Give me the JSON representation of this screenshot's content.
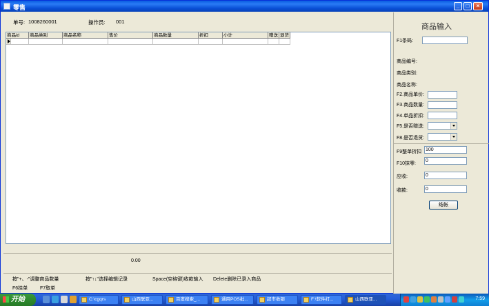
{
  "window": {
    "title": "零售"
  },
  "header": {
    "order_label": "单号:",
    "order_value": "1008260001",
    "operator_label": "操作员:",
    "operator_value": "001"
  },
  "grid": {
    "columns": [
      "商品id",
      "商品类别",
      "商品名称",
      "售价",
      "商品数量",
      "折扣",
      "小计",
      "赠送",
      "退货"
    ]
  },
  "totals": {
    "amount": "0.00"
  },
  "hints": {
    "adjust_qty": "按\"+、-\"调整商品数量",
    "select_record": "按\"↑↓\"选择编辑记录",
    "space_payment": "Space(空格键)收款输入",
    "delete_item": "Delete删除已录入商品",
    "hold_order": "F6挂单",
    "retrieve_order": "F7取单"
  },
  "panel": {
    "title": "商品输入",
    "barcode_label": "F1条码:",
    "barcode_value": "",
    "item_no_label": "商品编号:",
    "category_label": "商品类别:",
    "name_label": "商品名称:",
    "price_label": "F2.商品单价:",
    "qty_label": "F3.商品数量:",
    "item_discount_label": "F4.单品折扣:",
    "gift_label": "F5.是否赠送:",
    "return_label": "F8.是否退货:",
    "order_discount_label": "F9整单折扣",
    "order_discount_value": "100",
    "rounding_label": "F10抹零:",
    "rounding_value": "0",
    "receivable_label": "应收:",
    "receivable_value": "0",
    "received_label": "收款:",
    "received_value": "0",
    "checkout_button": "结帐"
  },
  "taskbar": {
    "start_label": "开始",
    "tasks": [
      "C:\\cgqrs",
      "山西联亚...",
      "百度搜索_...",
      "通用POS批...",
      "超市收银",
      "F:\\软件打...",
      "山西联亚..."
    ],
    "clock": "7:59"
  }
}
